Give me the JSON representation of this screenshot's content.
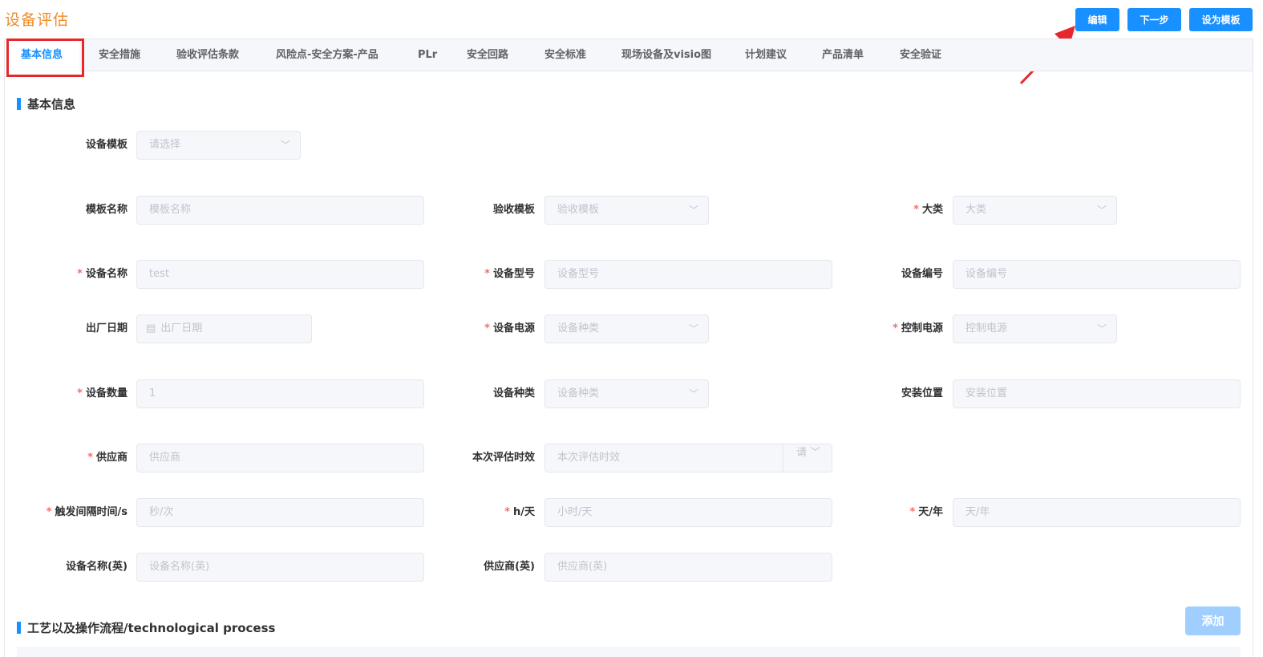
{
  "page": {
    "title": "设备评估"
  },
  "buttons": {
    "edit": "编辑",
    "next": "下一步",
    "set_template": "设为模板",
    "add": "添加"
  },
  "tabs": [
    "基本信息",
    "安全措施",
    "验收评估条款",
    "风险点-安全方案-产品",
    "PLr",
    "安全回路",
    "安全标准",
    "现场设备及visio图",
    "计划建议",
    "产品清单",
    "安全验证"
  ],
  "active_tab": 0,
  "sections": {
    "basic": "基本信息",
    "process": "工艺以及操作流程/technological process"
  },
  "colors": {
    "accent": "#1890ff",
    "title": "#f08a24",
    "required": "#f56c6c",
    "highlight": "#e6282d"
  },
  "form": {
    "device_template": {
      "label": "设备模板",
      "placeholder": "请选择"
    },
    "template_name": {
      "label": "模板名称",
      "placeholder": "模板名称"
    },
    "acceptance_template": {
      "label": "验收模板",
      "placeholder": "验收模板"
    },
    "category": {
      "label": "大类",
      "placeholder": "大类",
      "required": true
    },
    "device_name": {
      "label": "设备名称",
      "value": "test",
      "required": true
    },
    "device_model": {
      "label": "设备型号",
      "placeholder": "设备型号",
      "required": true
    },
    "device_number": {
      "label": "设备编号",
      "placeholder": "设备编号"
    },
    "factory_date": {
      "label": "出厂日期",
      "placeholder": "出厂日期"
    },
    "device_power": {
      "label": "设备电源",
      "placeholder": "设备种类",
      "required": true
    },
    "control_power": {
      "label": "控制电源",
      "placeholder": "控制电源",
      "required": true
    },
    "device_quantity": {
      "label": "设备数量",
      "value": "1",
      "required": true
    },
    "device_type": {
      "label": "设备种类",
      "placeholder": "设备种类"
    },
    "install_location": {
      "label": "安装位置",
      "placeholder": "安装位置"
    },
    "supplier": {
      "label": "供应商",
      "placeholder": "供应商",
      "required": true
    },
    "eval_validity": {
      "label": "本次评估时效",
      "placeholder": "本次评估时效",
      "addon": "请"
    },
    "trigger_interval": {
      "label": "触发间隔时间/s",
      "placeholder": "秒/次",
      "required": true
    },
    "hours_per_day": {
      "label": "h/天",
      "placeholder": "小时/天",
      "required": true
    },
    "days_per_year": {
      "label": "天/年",
      "placeholder": "天/年",
      "required": true
    },
    "device_name_en": {
      "label": "设备名称(英)",
      "placeholder": "设备名称(英)"
    },
    "supplier_en": {
      "label": "供应商(英)",
      "placeholder": "供应商(英)"
    }
  },
  "icons": {
    "dropdown": "chevron-down-icon",
    "calendar": "calendar-icon",
    "annotation": "red-arrow-icon"
  }
}
